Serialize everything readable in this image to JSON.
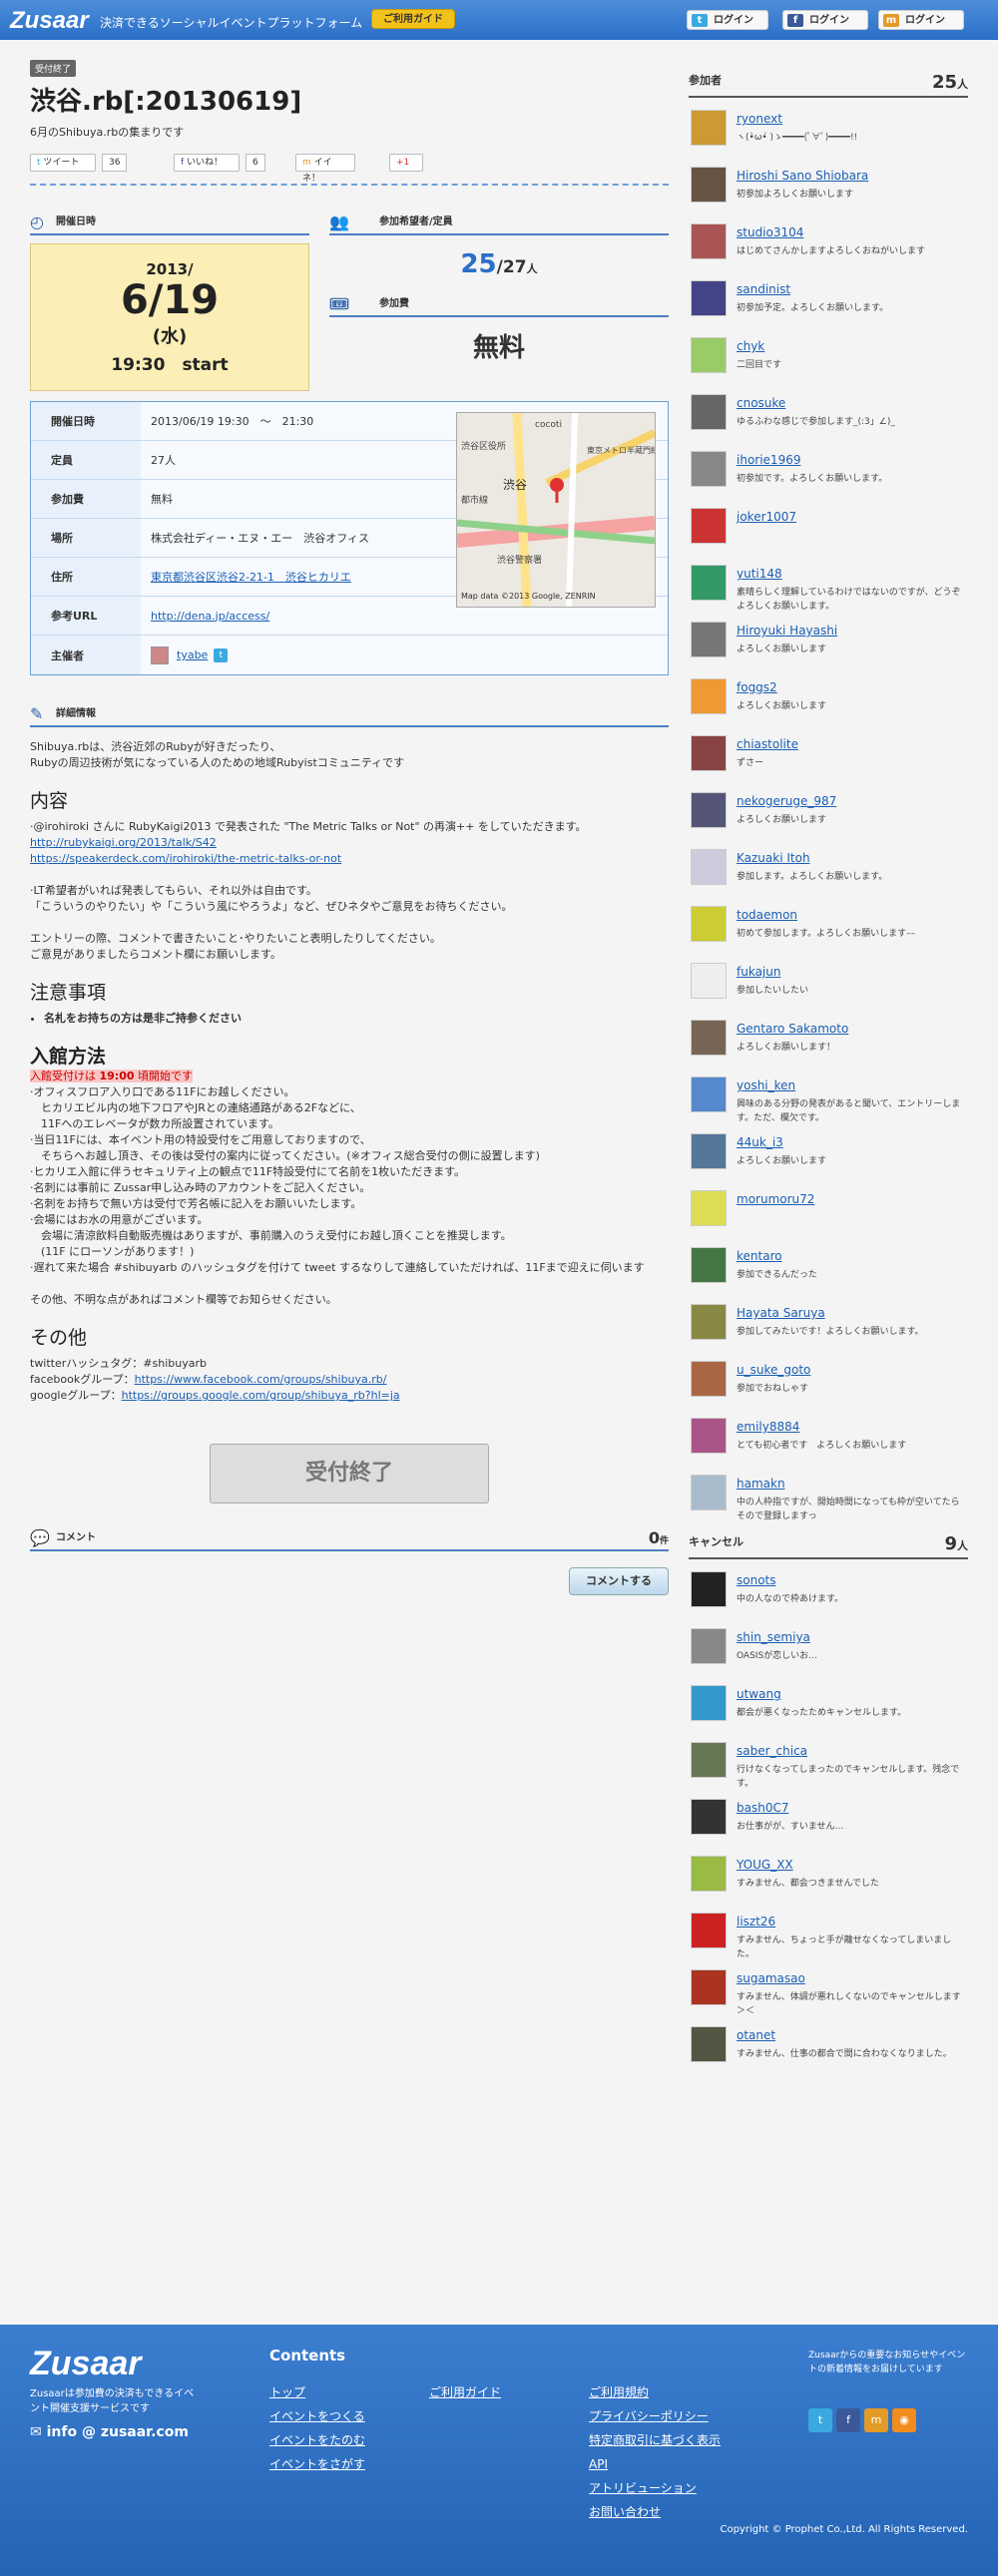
{
  "header": {
    "logo": "Zusaar",
    "tagline": "決済できるソーシャルイベントプラットフォーム",
    "guide": "ご利用ガイド",
    "twitter_login": "ログイン",
    "facebook_login": "ログイン",
    "mixi_login": "ログイン"
  },
  "event": {
    "badge": "受付終了",
    "title": "渋谷.rb[:20130619]",
    "subtitle": "6月のShibuya.rbの集まりです",
    "tweet": "ツイート",
    "tweet_count": "36",
    "like": "いいね！",
    "like_count": "6",
    "iine": "イイネ！",
    "plus": "+1"
  },
  "schedule": {
    "head": "開催日時",
    "year": "2013/",
    "date": "6/19",
    "weekday": "(水)",
    "time": "19:30　start"
  },
  "attendance": {
    "head": "参加希望者/定員",
    "count": "25",
    "cap": "/27",
    "unit": "人"
  },
  "fee": {
    "head": "参加費",
    "value": "無料"
  },
  "info": [
    {
      "k": "開催日時",
      "v": "2013/06/19 19:30　～　21:30"
    },
    {
      "k": "定員",
      "v": "27人"
    },
    {
      "k": "参加費",
      "v": "無料"
    },
    {
      "k": "場所",
      "v": "株式会社ディー・エヌ・エー　渋谷オフィス"
    },
    {
      "k": "住所",
      "v": "東京都渋谷区渋谷2-21-1　渋谷ヒカリエ"
    },
    {
      "k": "参考URL",
      "v": "http://dena.jp/access/"
    },
    {
      "k": "主催者",
      "v": "tyabe"
    }
  ],
  "map": {
    "labels": [
      "cocoti",
      "渋谷",
      "渋谷区役所",
      "都市線",
      "渋谷警察署",
      "東京メトロ半蔵門線"
    ],
    "credit": "Map data ©2013 Google, ZENRIN"
  },
  "details": {
    "head": "詳細情報",
    "intro": [
      "Shibuya.rbは、渋谷近郊のRubyが好きだったり、",
      "Rubyの周辺技術が気になっている人のための地域Rubyistコミュニティです"
    ]
  },
  "content": {
    "h": "内容",
    "lines": [
      "·@irohiroki さんに RubyKaigi2013 で発表された \"The Metric Talks or Not\" の再演++ をしていただきます。"
    ],
    "link1": "http://rubykaigi.org/2013/talk/S42",
    "link2": "https://speakerdeck.com/irohiroki/the-metric-talks-or-not",
    "lt": [
      "·LT希望者がいれば発表してもらい、それ以外は自由です。",
      "「こういうのやりたい」や「こういう風にやろうよ」など、ぜひネタやご意見をお待ちください。"
    ],
    "entry": [
      "エントリーの際、コメントで書きたいこと･やりたいこと表明したりしてください。",
      "ご意見がありましたらコメント欄にお願いします。"
    ]
  },
  "notice": {
    "h": "注意事項",
    "item": "名札をお持ちの方は是非ご持参ください"
  },
  "entrance": {
    "h": "入館方法",
    "hl_pre": "入館受付けは ",
    "hl_time": "19:00",
    "hl_post": " 頃開始です",
    "lines": [
      "·オフィスフロア入り口である11Fにお越しください。",
      "　ヒカリエビル内の地下フロアやJRとの連絡通路がある2Fなどに、",
      "　11Fへのエレベータが数カ所設置されています。",
      "·当日11Fには、本イベント用の特設受付をご用意しておりますので、",
      "　そちらへお越し頂き、その後は受付の案内に従ってください。(※オフィス総合受付の側に設置します)",
      "·ヒカリエ入館に伴うセキュリティ上の観点で11F特設受付にて名前を1枚いただきます。",
      "·名刺には事前に Zussar申し込み時のアカウントをご記入ください。",
      "·名刺をお持ちで無い方は受付で芳名帳に記入をお願いいたします。",
      "·会場にはお水の用意がございます。",
      "　会場に清涼飲料自動販売機はありますが、事前購入のうえ受付にお越し頂くことを推奨します。",
      "　(11F にローソンがあります！)",
      "·遅れて来た場合 #shibuyarb のハッシュタグを付けて tweet するなりして連絡していただければ、11Fまで迎えに伺います",
      "",
      "その他、不明な点があればコメント欄等でお知らせください。"
    ]
  },
  "other": {
    "h": "その他",
    "hashtag": "twitterハッシュタグ：#shibuyarb",
    "fb_label": "facebookグループ：",
    "fb_url": "https://www.facebook.com/groups/shibuya.rb/",
    "g_label": "googleグループ：",
    "g_url": "https://groups.google.com/group/shibuya_rb?hl=ja"
  },
  "closed": "受付終了",
  "comments": {
    "head": "コメント",
    "count": "0",
    "unit": "件",
    "button": "コメントする"
  },
  "participants": {
    "head": "参加者",
    "count": "25",
    "unit": "人",
    "list": [
      {
        "n": "ryonext",
        "c": "ヽ(•̀ω•́ )ゝ━━━━(ﾟ∀ﾟ)━━━━!!",
        "col": "#c93"
      },
      {
        "n": "Hiroshi Sano Shiobara",
        "c": "初参加よろしくお願いします",
        "col": "#654"
      },
      {
        "n": "studio3104",
        "c": "はじめてさんかしますよろしくおねがいします",
        "col": "#a55"
      },
      {
        "n": "sandinist",
        "c": "初参加予定。よろしくお願いします。",
        "col": "#448"
      },
      {
        "n": "chyk",
        "c": "二回目です",
        "col": "#9c6"
      },
      {
        "n": "cnosuke",
        "c": "ゆるふわな感じで参加します_(:3」∠)_",
        "col": "#666"
      },
      {
        "n": "ihorie1969",
        "c": "初参加です。よろしくお願いします。",
        "col": "#888"
      },
      {
        "n": "joker1007",
        "c": "",
        "col": "#c33"
      },
      {
        "n": "yuti148",
        "c": "素晴らしく理解しているわけではないのですが、どうぞよろしくお願いします。",
        "col": "#396"
      },
      {
        "n": "Hiroyuki Hayashi",
        "c": "よろしくお願いします",
        "col": "#777"
      },
      {
        "n": "foggs2",
        "c": "よろしくお願いします",
        "col": "#e93"
      },
      {
        "n": "chiastolite",
        "c": "ずさー",
        "col": "#844"
      },
      {
        "n": "nekogeruge_987",
        "c": "よろしくお願いします",
        "col": "#557"
      },
      {
        "n": "Kazuaki Itoh",
        "c": "参加します。よろしくお願いします。",
        "col": "#ccd"
      },
      {
        "n": "todaemon",
        "c": "初めて参加します。よろしくお願いします––",
        "col": "#cc3"
      },
      {
        "n": "fukajun",
        "c": "参加したいしたい",
        "col": "#eee"
      },
      {
        "n": "Gentaro Sakamoto",
        "c": "よろしくお願いします！",
        "col": "#765"
      },
      {
        "n": "yoshi_ken",
        "c": "興味のある分野の発表があると聞いて、エントリーします。ただ、欄欠です。",
        "col": "#58c"
      },
      {
        "n": "44uk_i3",
        "c": "よろしくお願いします",
        "col": "#579"
      },
      {
        "n": "morumoru72",
        "c": "",
        "col": "#dd5"
      },
      {
        "n": "kentaro",
        "c": "参加できるんだった",
        "col": "#474"
      },
      {
        "n": "Hayata Saruya",
        "c": "参加してみたいです！よろしくお願いします。",
        "col": "#884"
      },
      {
        "n": "u_suke_goto",
        "c": "参加でおねしゃす",
        "col": "#a64"
      },
      {
        "n": "emily8884",
        "c": "とても初心者です　よろしくお願いします",
        "col": "#a58"
      },
      {
        "n": "hamakn",
        "c": "中の人枠指ですが、開始時間になっても枠が空いてたらそので登録しますっ",
        "col": "#abc"
      }
    ]
  },
  "cancels": {
    "head": "キャンセル",
    "count": "9",
    "unit": "人",
    "list": [
      {
        "n": "sonots",
        "c": "中の人なので枠あけます。",
        "col": "#222"
      },
      {
        "n": "shin_semiya",
        "c": "OASISが恋しいお…",
        "col": "#888"
      },
      {
        "n": "utwang",
        "c": "都会が悪くなったためキャンセルします。",
        "col": "#39c"
      },
      {
        "n": "saber_chica",
        "c": "行けなくなってしまったのでキャンセルします。残念です。",
        "col": "#675"
      },
      {
        "n": "bash0C7",
        "c": "お仕事がが、すいません…",
        "col": "#333"
      },
      {
        "n": "YOUG_XX",
        "c": "すみません、都会つきませんでした",
        "col": "#9b4"
      },
      {
        "n": "liszt26",
        "c": "すみません、ちょっと手が離せなくなってしまいました。",
        "col": "#c22"
      },
      {
        "n": "sugamasao",
        "c": "すみません、体調が悪れしくないのでキャンセルします＞＜",
        "col": "#a32"
      },
      {
        "n": "otanet",
        "c": "すみません、仕事の都合で間に合わなくなりました。",
        "col": "#554"
      }
    ]
  },
  "footer": {
    "logo": "Zusaar",
    "desc": "Zusaarは参加費の決済もできるイベント開催支援サービスです",
    "mail": "info @ zusaar.com",
    "contents": "Contents",
    "links1": [
      "トップ",
      "イベントをつくる",
      "イベントをたのむ",
      "イベントをさがす"
    ],
    "links2": [
      "ご利用ガイド"
    ],
    "links3": [
      "ご利用規約",
      "プライバシーポリシー",
      "特定商取引に基づく表示",
      "API",
      "アトリビューション",
      "お問い合わせ"
    ],
    "news": "Zusaarからの重要なお知らせやイベントの新着情報をお届けしています",
    "copyright": "Copyright © Prophet Co.,Ltd. All Rights Reserved."
  }
}
